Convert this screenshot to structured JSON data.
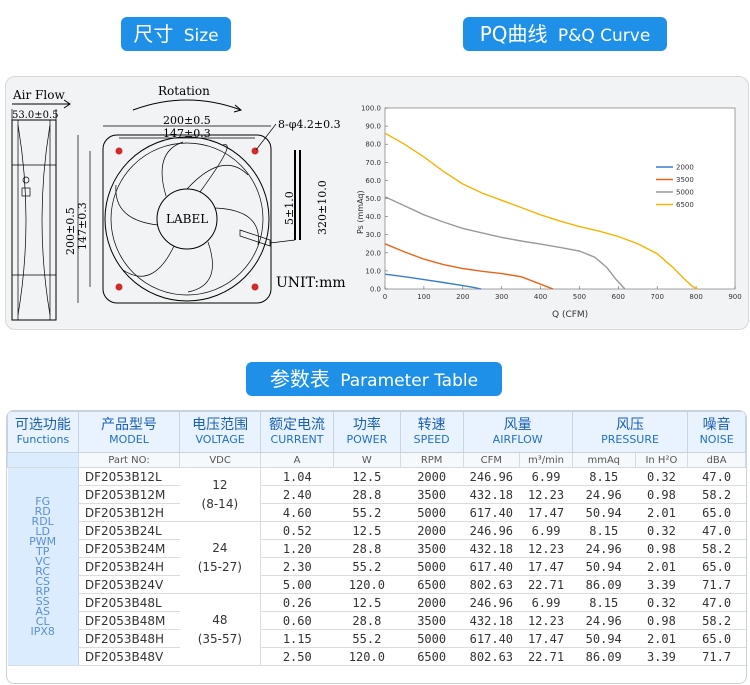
{
  "headings": {
    "size_cn": "尺寸",
    "size_en": "Size",
    "curve_cn": "PQ曲线",
    "curve_en": "P&Q Curve",
    "table_cn": "参数表",
    "table_en": "Parameter Table"
  },
  "drawing": {
    "air_flow": "Air Flow",
    "thickness": "53.0±0.5",
    "rotation": "Rotation",
    "dim_outer": "200±0.5",
    "dim_hole": "147±0.3",
    "holes": "8-φ4.2±0.3",
    "dim_height": "200±0.5",
    "dim_height_inner": "147±0.3",
    "lead_a": "5±1.0",
    "lead_b": "320±10.0",
    "label": "LABEL",
    "unit": "UNIT:mm"
  },
  "chart_data": {
    "type": "line",
    "xlabel": "Q (CFM)",
    "ylabel": "Ps (mmAq)",
    "xlim": [
      0,
      900
    ],
    "ylim": [
      0,
      100
    ],
    "x_ticks": [
      "0",
      "100",
      "200",
      "300",
      "400",
      "500",
      "600",
      "700",
      "800",
      "900"
    ],
    "y_ticks": [
      "0.0",
      "10.0",
      "20.0",
      "30.0",
      "40.0",
      "50.0",
      "60.0",
      "70.0",
      "80.0",
      "90.0",
      "100.0"
    ],
    "legend_position": "right",
    "series": [
      {
        "name": "2000",
        "color": "#3a7dd1",
        "x": [
          0,
          50,
          100,
          150,
          200,
          230,
          247
        ],
        "y": [
          8.15,
          6.8,
          5.2,
          3.6,
          1.9,
          0.8,
          0
        ]
      },
      {
        "name": "3500",
        "color": "#e8641a",
        "x": [
          0,
          50,
          100,
          150,
          200,
          250,
          300,
          350,
          390,
          420,
          432
        ],
        "y": [
          24.96,
          20.5,
          16.5,
          13.5,
          11.3,
          9.8,
          8.5,
          6.8,
          3.5,
          1.0,
          0
        ]
      },
      {
        "name": "5000",
        "color": "#999999",
        "x": [
          0,
          50,
          100,
          150,
          200,
          250,
          300,
          350,
          400,
          450,
          500,
          540,
          570,
          595,
          617
        ],
        "y": [
          50.94,
          46.0,
          41.0,
          37.0,
          33.5,
          31.0,
          28.5,
          26.5,
          24.8,
          23.0,
          21.0,
          17.5,
          12.0,
          5.0,
          0
        ]
      },
      {
        "name": "6500",
        "color": "#f5b400",
        "x": [
          0,
          50,
          100,
          150,
          200,
          250,
          300,
          350,
          400,
          450,
          500,
          550,
          600,
          650,
          700,
          740,
          770,
          790,
          803
        ],
        "y": [
          86.09,
          80.0,
          73.0,
          65.0,
          58.0,
          53.0,
          49.0,
          45.0,
          41.0,
          37.5,
          34.5,
          32.0,
          29.0,
          25.0,
          19.5,
          12.0,
          5.5,
          1.5,
          0
        ]
      }
    ]
  },
  "table": {
    "headers": [
      {
        "cn": "可选功能",
        "en": "Functions"
      },
      {
        "cn": "产品型号",
        "en": "MODEL"
      },
      {
        "cn": "电压范围",
        "en": "VOLTAGE"
      },
      {
        "cn": "额定电流",
        "en": "CURRENT"
      },
      {
        "cn": "功率",
        "en": "POWER"
      },
      {
        "cn": "转速",
        "en": "SPEED"
      },
      {
        "cn": "风量",
        "en": "AIRFLOW"
      },
      {
        "cn": "风压",
        "en": "PRESSURE"
      },
      {
        "cn": "噪音",
        "en": "NOISE"
      }
    ],
    "units": [
      "Part NO:",
      "VDC",
      "A",
      "W",
      "RPM",
      "CFM",
      "m³/min",
      "mmAq",
      "In H²O",
      "dBA"
    ],
    "functions": [
      "FG",
      "RD",
      "RDL",
      "LD",
      "PWM",
      "TP",
      "VC",
      "RC",
      "CS",
      "RP",
      "SS",
      "AS",
      "CL",
      "IPX8"
    ],
    "voltage_groups": [
      {
        "nominal": "12",
        "range": "(8-14)"
      },
      {
        "nominal": "24",
        "range": "(15-27)"
      },
      {
        "nominal": "48",
        "range": "(35-57)"
      }
    ],
    "rows": [
      {
        "model": "DF2053B12L",
        "current": "1.04",
        "power": "12.5",
        "speed": "2000",
        "cfm": "246.96",
        "m3": "6.99",
        "mmaq": "8.15",
        "inh2o": "0.32",
        "noise": "47.0"
      },
      {
        "model": "DF2053B12M",
        "current": "2.40",
        "power": "28.8",
        "speed": "3500",
        "cfm": "432.18",
        "m3": "12.23",
        "mmaq": "24.96",
        "inh2o": "0.98",
        "noise": "58.2"
      },
      {
        "model": "DF2053B12H",
        "current": "4.60",
        "power": "55.2",
        "speed": "5000",
        "cfm": "617.40",
        "m3": "17.47",
        "mmaq": "50.94",
        "inh2o": "2.01",
        "noise": "65.0"
      },
      {
        "model": "DF2053B24L",
        "current": "0.52",
        "power": "12.5",
        "speed": "2000",
        "cfm": "246.96",
        "m3": "6.99",
        "mmaq": "8.15",
        "inh2o": "0.32",
        "noise": "47.0"
      },
      {
        "model": "DF2053B24M",
        "current": "1.20",
        "power": "28.8",
        "speed": "3500",
        "cfm": "432.18",
        "m3": "12.23",
        "mmaq": "24.96",
        "inh2o": "0.98",
        "noise": "58.2"
      },
      {
        "model": "DF2053B24H",
        "current": "2.30",
        "power": "55.2",
        "speed": "5000",
        "cfm": "617.40",
        "m3": "17.47",
        "mmaq": "50.94",
        "inh2o": "2.01",
        "noise": "65.0"
      },
      {
        "model": "DF2053B24V",
        "current": "5.00",
        "power": "120.0",
        "speed": "6500",
        "cfm": "802.63",
        "m3": "22.71",
        "mmaq": "86.09",
        "inh2o": "3.39",
        "noise": "71.7"
      },
      {
        "model": "DF2053B48L",
        "current": "0.26",
        "power": "12.5",
        "speed": "2000",
        "cfm": "246.96",
        "m3": "6.99",
        "mmaq": "8.15",
        "inh2o": "0.32",
        "noise": "47.0"
      },
      {
        "model": "DF2053B48M",
        "current": "0.60",
        "power": "28.8",
        "speed": "3500",
        "cfm": "432.18",
        "m3": "12.23",
        "mmaq": "24.96",
        "inh2o": "0.98",
        "noise": "58.2"
      },
      {
        "model": "DF2053B48H",
        "current": "1.15",
        "power": "55.2",
        "speed": "5000",
        "cfm": "617.40",
        "m3": "17.47",
        "mmaq": "50.94",
        "inh2o": "2.01",
        "noise": "65.0"
      },
      {
        "model": "DF2053B48V",
        "current": "2.50",
        "power": "120.0",
        "speed": "6500",
        "cfm": "802.63",
        "m3": "22.71",
        "mmaq": "86.09",
        "inh2o": "3.39",
        "noise": "71.7"
      }
    ]
  }
}
